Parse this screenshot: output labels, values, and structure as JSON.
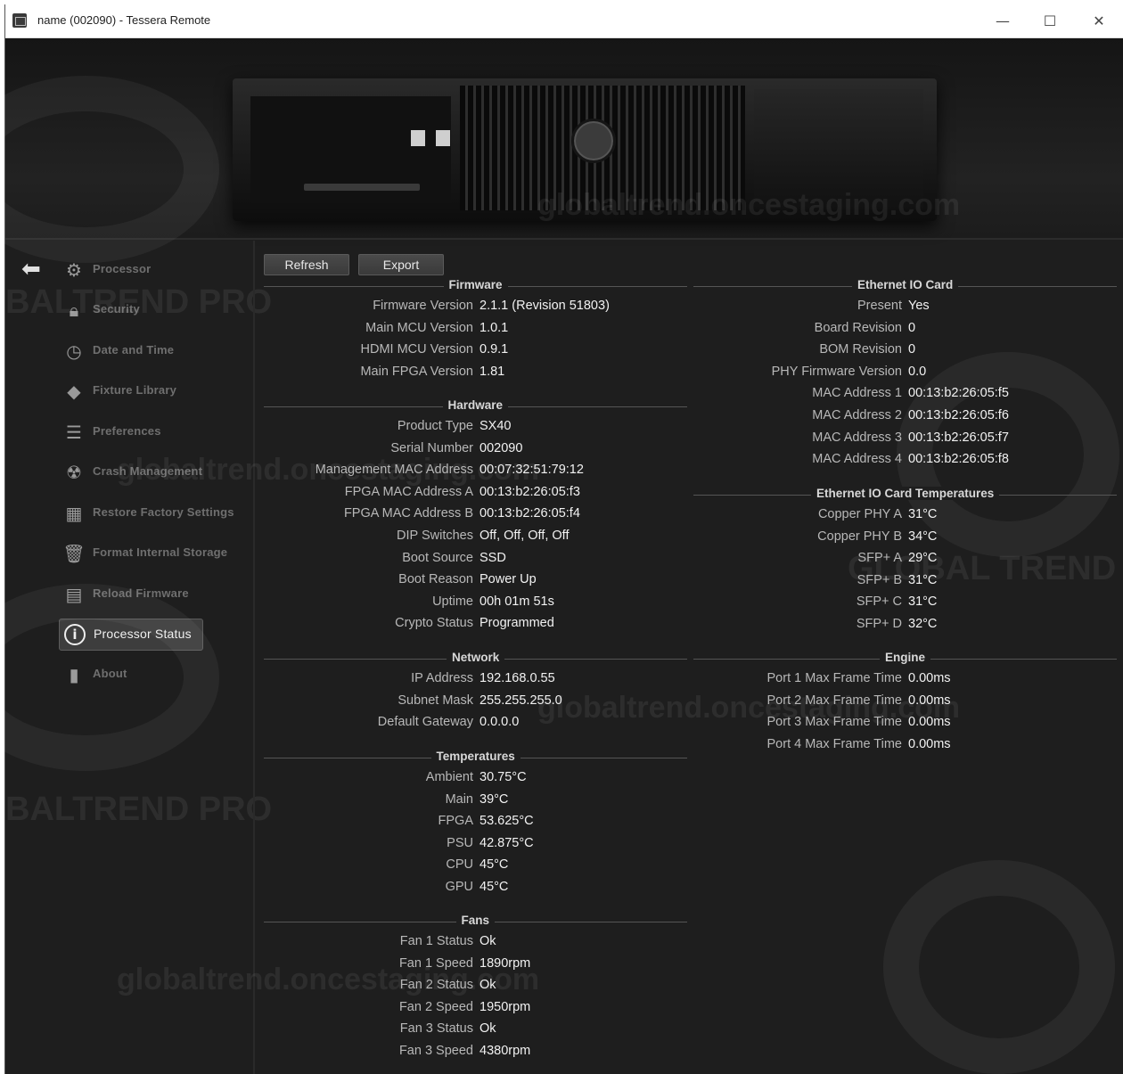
{
  "window": {
    "title": "name (002090) - Tessera Remote",
    "minimize": "—",
    "maximize": "☐",
    "close": "✕"
  },
  "watermarks": {
    "site": "globaltrend.oncestaging.com",
    "brand_pro": "BALTREND PRO",
    "brand": "GLOBAL TREND"
  },
  "toolbar": {
    "refresh_label": "Refresh",
    "export_label": "Export"
  },
  "sidebar": {
    "items": [
      {
        "label": "Processor",
        "icon": "gear-icon"
      },
      {
        "label": "Security",
        "icon": "lock-icon"
      },
      {
        "label": "Date and Time",
        "icon": "clock-icon"
      },
      {
        "label": "Fixture Library",
        "icon": "fixture-icon"
      },
      {
        "label": "Preferences",
        "icon": "list-icon"
      },
      {
        "label": "Crash Management",
        "icon": "radiation-icon"
      },
      {
        "label": "Restore Factory Settings",
        "icon": "factory-icon"
      },
      {
        "label": "Format Internal Storage",
        "icon": "trash-icon"
      },
      {
        "label": "Reload Firmware",
        "icon": "firmware-icon"
      },
      {
        "label": "Processor Status",
        "icon": "info-icon"
      },
      {
        "label": "About",
        "icon": "book-icon"
      }
    ]
  },
  "firmware": {
    "heading": "Firmware",
    "rows": [
      {
        "k": "Firmware Version",
        "v": "2.1.1 (Revision 51803)"
      },
      {
        "k": "Main MCU Version",
        "v": "1.0.1"
      },
      {
        "k": "HDMI MCU Version",
        "v": "0.9.1"
      },
      {
        "k": "Main FPGA Version",
        "v": "1.81"
      }
    ]
  },
  "hardware": {
    "heading": "Hardware",
    "rows": [
      {
        "k": "Product Type",
        "v": "SX40"
      },
      {
        "k": "Serial Number",
        "v": "002090"
      },
      {
        "k": "Management MAC Address",
        "v": "00:07:32:51:79:12"
      },
      {
        "k": "FPGA MAC Address A",
        "v": "00:13:b2:26:05:f3"
      },
      {
        "k": "FPGA MAC Address B",
        "v": "00:13:b2:26:05:f4"
      },
      {
        "k": "DIP Switches",
        "v": "Off, Off, Off, Off"
      },
      {
        "k": "Boot Source",
        "v": "SSD"
      },
      {
        "k": "Boot Reason",
        "v": "Power Up"
      },
      {
        "k": "Uptime",
        "v": "00h 01m 51s"
      },
      {
        "k": "Crypto Status",
        "v": "Programmed"
      }
    ]
  },
  "network": {
    "heading": "Network",
    "rows": [
      {
        "k": "IP Address",
        "v": "192.168.0.55"
      },
      {
        "k": "Subnet Mask",
        "v": "255.255.255.0"
      },
      {
        "k": "Default Gateway",
        "v": "0.0.0.0"
      }
    ]
  },
  "temperatures": {
    "heading": "Temperatures",
    "rows": [
      {
        "k": "Ambient",
        "v": "30.75°C"
      },
      {
        "k": "Main",
        "v": "39°C"
      },
      {
        "k": "FPGA",
        "v": "53.625°C"
      },
      {
        "k": "PSU",
        "v": "42.875°C"
      },
      {
        "k": "CPU",
        "v": "45°C"
      },
      {
        "k": "GPU",
        "v": "45°C"
      }
    ]
  },
  "fans": {
    "heading": "Fans",
    "rows": [
      {
        "k": "Fan 1 Status",
        "v": "Ok"
      },
      {
        "k": "Fan 1 Speed",
        "v": "1890rpm"
      },
      {
        "k": "Fan 2 Status",
        "v": "Ok"
      },
      {
        "k": "Fan 2 Speed",
        "v": "1950rpm"
      },
      {
        "k": "Fan 3 Status",
        "v": "Ok"
      },
      {
        "k": "Fan 3 Speed",
        "v": "4380rpm"
      }
    ]
  },
  "ethernet_io": {
    "heading": "Ethernet IO Card",
    "rows": [
      {
        "k": "Present",
        "v": "Yes"
      },
      {
        "k": "Board Revision",
        "v": "0"
      },
      {
        "k": "BOM Revision",
        "v": "0"
      },
      {
        "k": "PHY Firmware Version",
        "v": "0.0"
      },
      {
        "k": "MAC Address 1",
        "v": "00:13:b2:26:05:f5"
      },
      {
        "k": "MAC Address 2",
        "v": "00:13:b2:26:05:f6"
      },
      {
        "k": "MAC Address 3",
        "v": "00:13:b2:26:05:f7"
      },
      {
        "k": "MAC Address 4",
        "v": "00:13:b2:26:05:f8"
      }
    ]
  },
  "ethernet_temps": {
    "heading": "Ethernet IO Card Temperatures",
    "rows": [
      {
        "k": "Copper PHY A",
        "v": "31°C"
      },
      {
        "k": "Copper PHY B",
        "v": "34°C"
      },
      {
        "k": "SFP+ A",
        "v": "29°C"
      },
      {
        "k": "SFP+ B",
        "v": "31°C"
      },
      {
        "k": "SFP+ C",
        "v": "31°C"
      },
      {
        "k": "SFP+ D",
        "v": "32°C"
      }
    ]
  },
  "engine": {
    "heading": "Engine",
    "rows": [
      {
        "k": "Port 1 Max Frame Time",
        "v": "0.00ms"
      },
      {
        "k": "Port 2 Max Frame Time",
        "v": "0.00ms"
      },
      {
        "k": "Port 3 Max Frame Time",
        "v": "0.00ms"
      },
      {
        "k": "Port 4 Max Frame Time",
        "v": "0.00ms"
      }
    ]
  }
}
